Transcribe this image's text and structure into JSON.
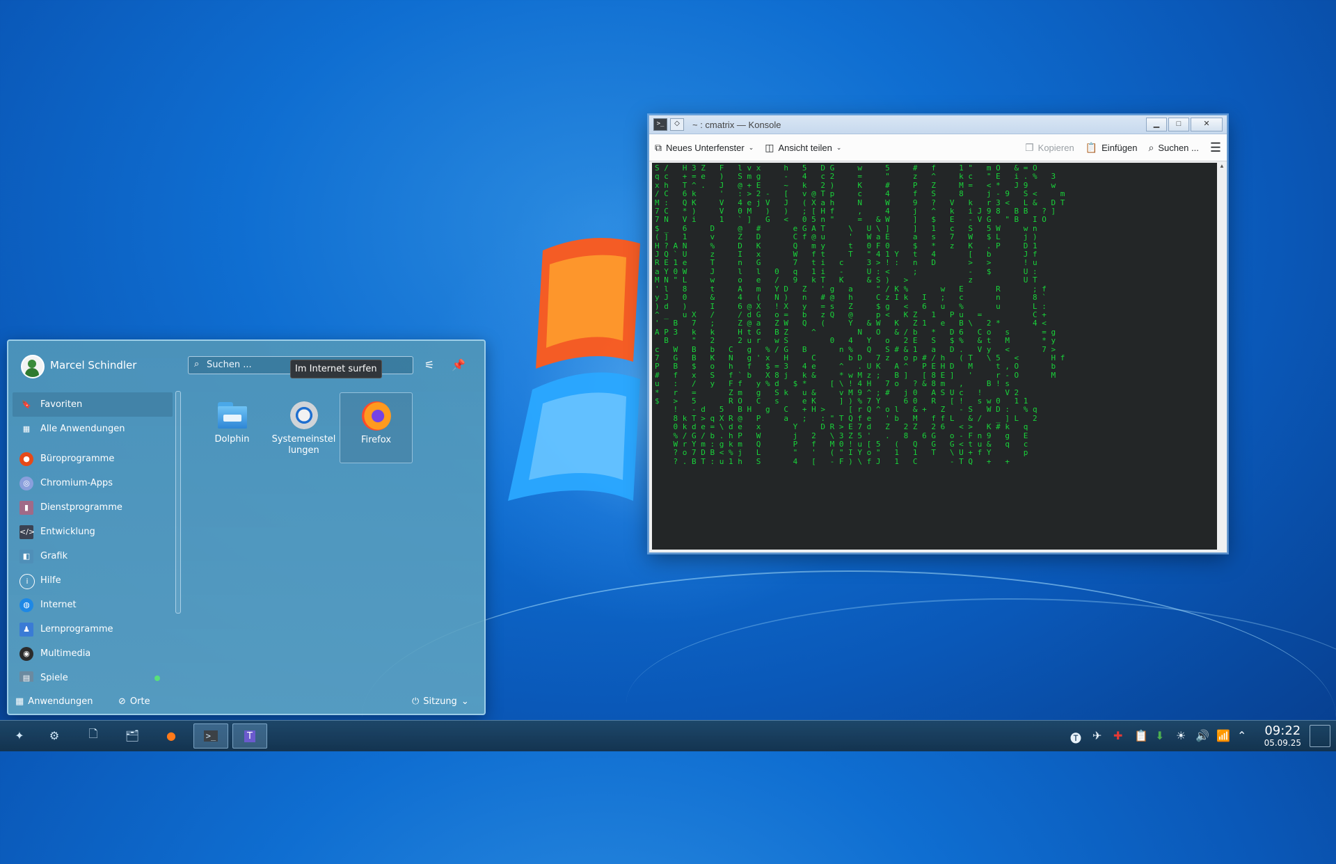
{
  "konsole": {
    "title": "~ : cmatrix — Konsole",
    "toolbar": {
      "new_tab": "Neues Unterfenster",
      "split_view": "Ansicht teilen",
      "copy": "Kopieren",
      "paste": "Einfügen",
      "find": "Suchen ..."
    },
    "terminal_text": "S /   H 3 Z   F   l v x     h   5   D G     w     5     #   f     1 \"   m O   & = O\nq c   + = e   )   S m g     -   4   c 2     =     \"     z   ^     k c   \" E   i . %   3\nx h   T ^ .   J   @ + E     ~   k   2 )     K     #     P   Z     M =   < *   J 9     w\n/ C   6 k     '   : > 2 -   [   v @ T p     c     4     f   S     8     j - 9   S <     m\nM :   Q K     V   4 e j V   J   ( X a h     N     W     9   ?   V   k   r 3 <   L &   D T\n7 C   * )     V   0 M   )   )   ; [ H f     ,     4     j   ^   k   i J 9 8   B B   ? ]\n7 N   V i     1   ` ]   G   <   0 5 n \"     =   & W     ]   $   E   - V G   \" B   I O\n$ _   6     D     @   #       e G A T     \\   U \\ ]     ]   1   c   S   5 W     w n\n( ]   1     v     Z   D       C f @ u     '   W a E     a   s   7   W   $ L     j )\nH ? A N     %     D   K       Q   m y     t   0 F 0     $   *   z   K   . P     D 1\nJ Q ` U     z     I   x       W   f t     T   \" 4 1 Y   t   4       [   b       J f\nR E 1 e     T     n   G       7   t i   c     3 > ! :   n   D       >   >       ! u\na Y 0 W     J     l   l   0   q   1 i   -     U : <     ;           -   $       U :\nM N \" L     w     o   e   /   9   k T   K     & S )   >             z           U T\n' l   8     t     A   m   Y D   Z   ' g   a     \" / K %       w   E       R       ; f\ny J   0     &     4   (   N )   n   # @   h     C z I k   I   ;   c       n       8 `\n) d   )     I     6 @ X   ! X   y   = s   Z     $ g   <   6   u   %       u       L :\n^ _   u X   /     / d G   o =   b   z Q   @     p <   K Z   1   P u   =           C +\n'   B   7   ;     Z @ a   Z W   Q   (     Y   & W   K   Z 1   e   B \\   2 *       4 <\nA P 3   k   k     H t G   B Z     ^         N   O   & / b   *   D 6   C o   s       = g\n  B     \"   2     2 u r   w S         0   4   Y   o   2 E   S   $ %   & t   M       * y\nc   W   B   b   C   g   % / G   B       n %   Q   S # & 1   a   D .   V y   <       7 >\n7   G   B   K   N   g ' x   H     C       b D   7 z   o p # / h   ( T   \\ 5   <       H f\nP   B   $   o   h   f   $ = 3   4 e     ^   . U K   A ^   P E H D   M     t , O       b\n#   f   x   S   f ` b   X 8 j   k &     * w M z ;   B ]   [ 8 E ]   '     r - O       M\nu   :   /   y   F f   y % d   $ *     [ \\ ! 4 H   7 o   ? & 8 m   ,     B ! s\n*   r   =       Z m   g   S k   u &     v M 9 ^ ; #   j 0   A S U c   !     V 2\n$   >   5       R O   C   s     e K     ] ) % 7 Y     6 0   R   [ !   s w 0   1 1\n    !   - d   5   B H   g   C   + H >     [ r Q ^ o l   & +   Z   - S   W D :   % q\n    8 k T > q X R @   P     a   ;   : \" T Q f e   ' b   M   f f L   & /   _ ] L   2\n    0 k d e = \\ d e   x       Y     D R > E 7 d   Z   2 Z   2 6   < >   K # k   q\n    % / G / b . h P   W       j   2   \\ 3 Z 5 '   .   8   6 G   o - F n 9   g   E\n    W r Y m : g k m   Q       P   f   M 0 ! u [ 5   (   Q   G   G < t u &   q   c\n    ? o 7 D B < % j   L       \"   '   ( \" I Y o \"   1   1   T   \\ U + f Y       p\n    ? . B T : u 1 h   S       4   [   - F ) \\ f J   1   C       - T Q   +   +"
  },
  "startmenu": {
    "username": "Marcel Schindler",
    "search_placeholder": "Suchen ...",
    "tooltip": "Im Internet surfen",
    "categories": [
      {
        "label": "Favoriten"
      },
      {
        "label": "Alle Anwendungen"
      },
      {
        "label": "Büroprogramme"
      },
      {
        "label": "Chromium-Apps"
      },
      {
        "label": "Dienstprogramme"
      },
      {
        "label": "Entwicklung"
      },
      {
        "label": "Grafik"
      },
      {
        "label": "Hilfe"
      },
      {
        "label": "Internet"
      },
      {
        "label": "Lernprogramme"
      },
      {
        "label": "Multimedia"
      },
      {
        "label": "Spiele"
      }
    ],
    "apps": [
      {
        "label": "Dolphin"
      },
      {
        "label": "Systemeinstel\nlungen"
      },
      {
        "label": "Firefox"
      }
    ],
    "footer": {
      "applications": "Anwendungen",
      "places": "Orte",
      "session": "Sitzung"
    }
  },
  "taskbar": {
    "time": "09:22",
    "date": "05.09.25"
  },
  "colors": {
    "terminal_bg": "#232627",
    "terminal_fg": "#19d33a",
    "desktop": "#0f6ed1"
  }
}
